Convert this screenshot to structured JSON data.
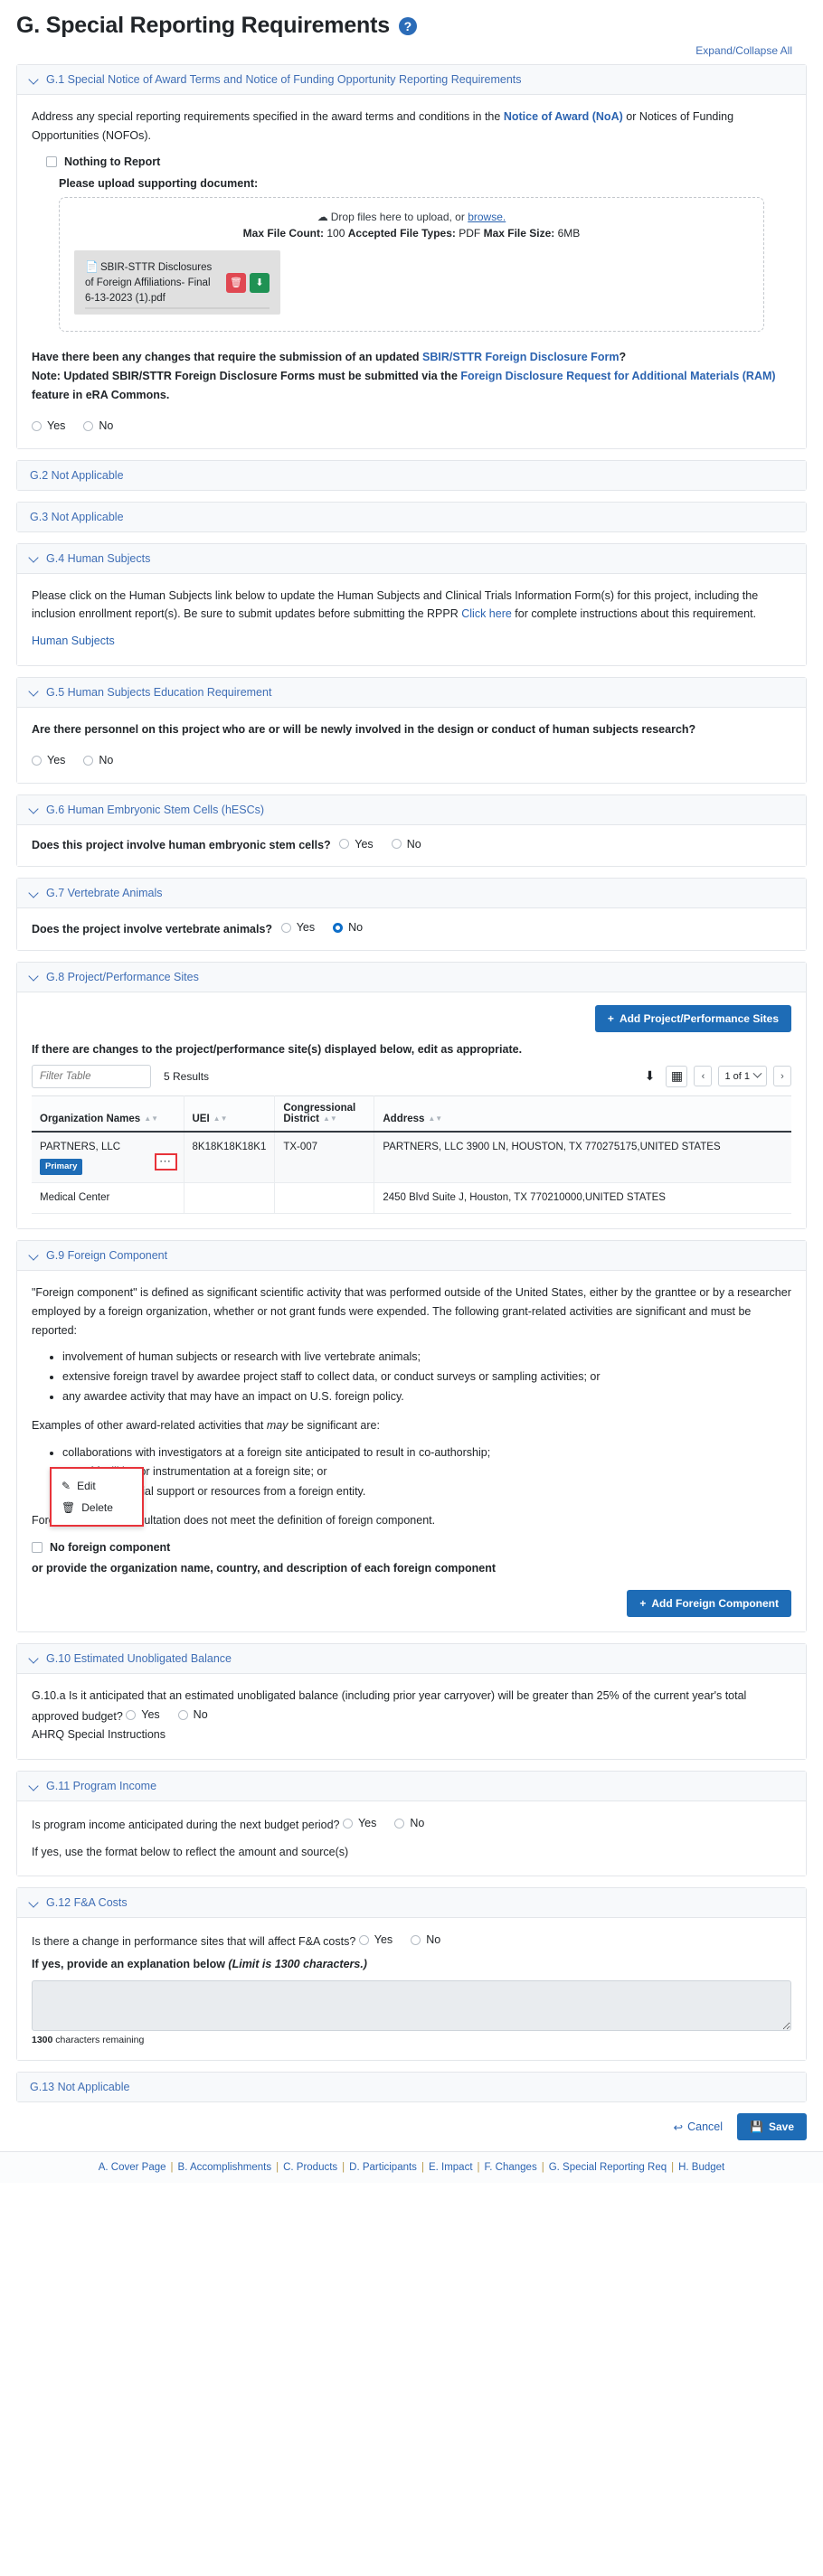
{
  "header": {
    "title": "G. Special Reporting Requirements",
    "help_icon": "question-circle-icon",
    "expand_collapse": "Expand/Collapse All"
  },
  "g1": {
    "heading": "G.1 Special Notice of Award Terms and Notice of Funding Opportunity Reporting Requirements",
    "intro_a": "Address any special reporting requirements specified in the award terms and conditions in the ",
    "intro_link": "Notice of Award (NoA)",
    "intro_b": " or Notices of Funding Opportunities (NOFOs).",
    "nothing_to_report": "Nothing to Report",
    "upload_label": "Please upload supporting document:",
    "drop_text": "Drop files here to upload, or ",
    "browse": "browse.",
    "max_count_label": "Max File Count:",
    "max_count_value": "100",
    "accepted_label": "Accepted File Types:",
    "accepted_value": "PDF",
    "max_size_label": "Max File Size:",
    "max_size_value": "6MB",
    "file_name": "SBIR-STTR Disclosures of Foreign Affiliations- Final 6-13-2023 (1).pdf",
    "delete_icon": "trash-icon",
    "download_icon": "download-icon",
    "q_a": "Have there been any changes that require the submission of an updated ",
    "q_link": "SBIR/STTR Foreign Disclosure Form",
    "q_b": "?",
    "note_a": "Note: Updated SBIR/STTR Foreign Disclosure Forms must be submitted via the ",
    "note_link": "Foreign Disclosure Request for Additional Materials (RAM)",
    "note_b": " feature in eRA Commons.",
    "yes": "Yes",
    "no": "No"
  },
  "g2": {
    "heading": "G.2 Not Applicable"
  },
  "g3": {
    "heading": "G.3 Not Applicable"
  },
  "g4": {
    "heading": "G.4 Human Subjects",
    "body_a": "Please click on the Human Subjects link below to update the Human Subjects and Clinical Trials Information Form(s) for this project, including the inclusion enrollment report(s). Be sure to submit updates before submitting the RPPR ",
    "body_link": "Click here",
    "body_b": " for complete instructions about this requirement.",
    "link": "Human Subjects"
  },
  "g5": {
    "heading": "G.5 Human Subjects Education Requirement",
    "question": "Are there personnel on this project who are or will be newly involved in the design or conduct of human subjects research?",
    "yes": "Yes",
    "no": "No"
  },
  "g6": {
    "heading": "G.6 Human Embryonic Stem Cells (hESCs)",
    "question": "Does this project involve human embryonic stem cells?",
    "yes": "Yes",
    "no": "No"
  },
  "g7": {
    "heading": "G.7 Vertebrate Animals",
    "question": "Does the project involve vertebrate animals?",
    "yes": "Yes",
    "no": "No",
    "selected": "No"
  },
  "g8": {
    "heading": "G.8 Project/Performance Sites",
    "add_button": "Add Project/Performance Sites",
    "note": "If there are changes to the project/performance site(s) displayed below, edit as appropriate.",
    "filter_placeholder": "Filter Table",
    "results": "5 Results",
    "export_icon": "download-icon",
    "columns_icon": "table-columns-icon",
    "prev_icon": "chevron-left-icon",
    "next_icon": "chevron-right-icon",
    "page_label": "1 of 1",
    "columns": [
      "Organization Names",
      "UEI",
      "Congressional District",
      "Address"
    ],
    "rows": [
      {
        "org": "PARTNERS, LLC",
        "badge": "Primary",
        "uei": "8K18K18K18K1",
        "district": "TX-007",
        "address": "PARTNERS, LLC 3900 LN, HOUSTON, TX 770275175,UNITED STATES"
      },
      {
        "org": "Medical Center",
        "badge": "",
        "uei": "",
        "district": "",
        "address": "2450 Blvd Suite J, Houston, TX 770210000,UNITED STATES"
      }
    ],
    "kebab_icon": "ellipsis-icon",
    "context_menu": {
      "edit": "Edit",
      "edit_icon": "pencil-square-icon",
      "delete": "Delete",
      "delete_icon": "trash-icon"
    }
  },
  "g9": {
    "heading": "G.9 Foreign Component",
    "para1": "\"Foreign component\" is defined as significant scientific activity that was performed outside of the United States, either by the granttee or by a researcher employed by a foreign organization, whether or not grant funds were expended. The following grant-related activities are significant and must be reported:",
    "bullets1": [
      "involvement of human subjects or research with live vertebrate animals;",
      "extensive foreign travel by awardee project staff to collect data, or conduct surveys or sampling activities; or",
      "any awardee activity that may have an impact on U.S. foreign policy."
    ],
    "para2_a": "Examples of other award-related activities that ",
    "para2_em": "may",
    "para2_b": " be significant are:",
    "bullets2": [
      "collaborations with investigators at a foreign site anticipated to result in co-authorship;",
      "use of facilities or instrumentation at a foreign site; or",
      "receipt of financial support or resources from a foreign entity."
    ],
    "para3": "Foreign travel for consultation does not meet the definition of foreign component.",
    "checkbox_label": "No foreign component",
    "or_line": "or provide the organization name, country, and description of each foreign component",
    "add_button": "Add Foreign Component"
  },
  "g10": {
    "heading": "G.10 Estimated Unobligated Balance",
    "question": "G.10.a Is it anticipated that an estimated unobligated balance (including prior year carryover) will be greater than 25% of the current year's total approved budget?",
    "yes": "Yes",
    "no": "No",
    "ahrq": "AHRQ Special Instructions"
  },
  "g11": {
    "heading": "G.11 Program Income",
    "question": "Is program income anticipated during the next budget period?",
    "yes": "Yes",
    "no": "No",
    "hint": "If yes, use the format below to reflect the amount and source(s)"
  },
  "g12": {
    "heading": "G.12 F&A Costs",
    "question": "Is there a change in performance sites that will affect F&A costs?",
    "yes": "Yes",
    "no": "No",
    "explain_a": "If yes, provide an explanation below ",
    "explain_em": "(Limit is 1300 characters.)",
    "textarea_value": "",
    "chars_num": "1300",
    "chars_text": " characters remaining"
  },
  "g13": {
    "heading": "G.13 Not Applicable"
  },
  "footer": {
    "cancel": "Cancel",
    "cancel_icon": "undo-arrow-icon",
    "save": "Save",
    "save_icon": "floppy-disk-icon",
    "nav": [
      "A. Cover Page",
      "B. Accomplishments",
      "C. Products",
      "D. Participants",
      "E. Impact",
      "F. Changes",
      "G. Special Reporting Req",
      "H. Budget"
    ]
  }
}
